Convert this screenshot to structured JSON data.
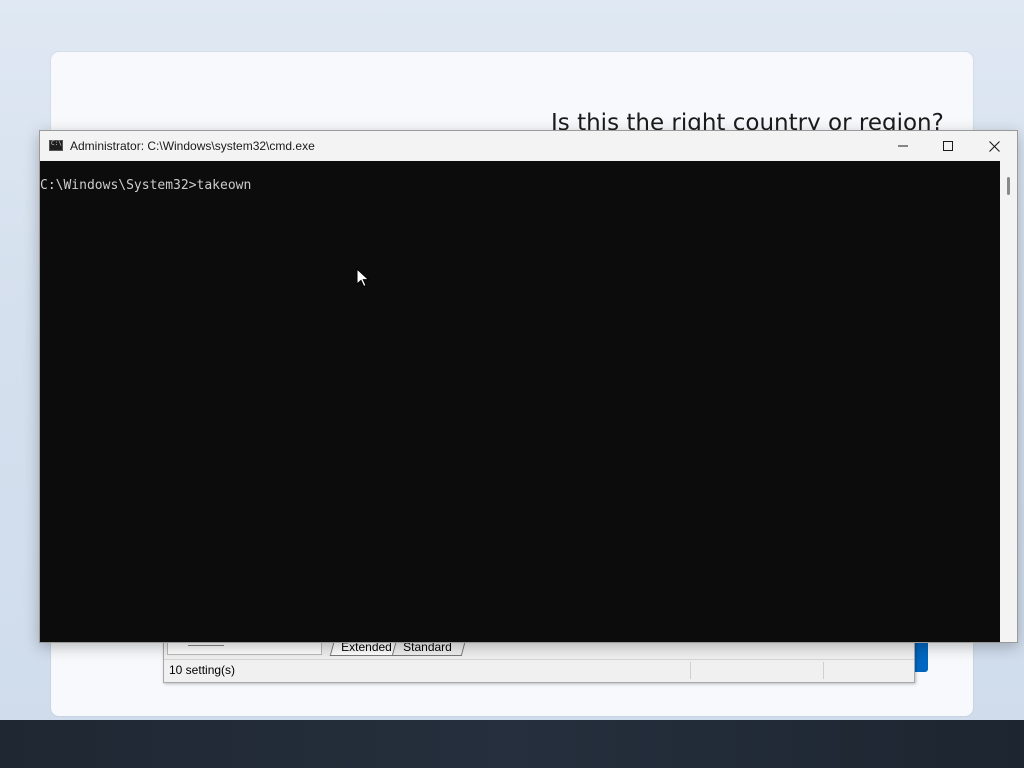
{
  "oobe": {
    "heading": "Is this the right country or region?"
  },
  "settings_window": {
    "tabs": [
      "Extended",
      "Standard"
    ],
    "status_text": "10 setting(s)"
  },
  "cmd": {
    "title": "Administrator: C:\\Windows\\system32\\cmd.exe",
    "prompt_line": "C:\\Windows\\System32>takeown",
    "icons": {
      "app": "cmd-icon",
      "minimize": "minimize-icon",
      "maximize": "maximize-icon",
      "close": "close-icon"
    }
  },
  "colors": {
    "console_bg": "#0c0c0c",
    "console_text": "#cccccc",
    "accent_blue": "#0067c0"
  }
}
